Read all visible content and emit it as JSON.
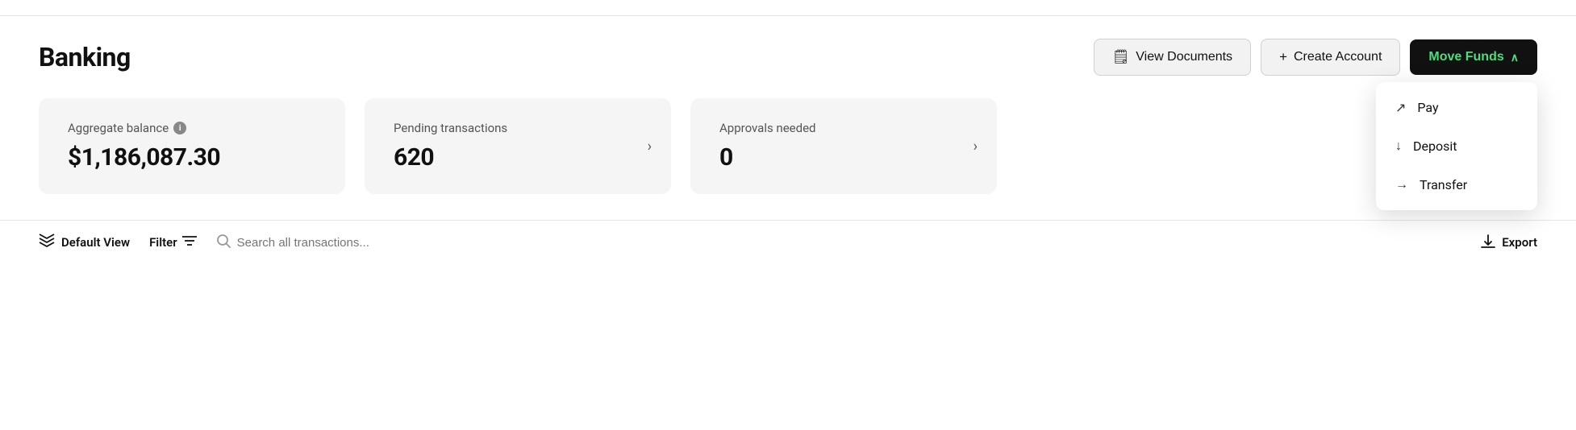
{
  "topbar": {},
  "header": {
    "title": "Banking",
    "actions": {
      "view_documents_label": "View Documents",
      "create_account_label": "Create Account",
      "create_account_prefix": "+",
      "move_funds_label": "Move Funds"
    }
  },
  "dropdown": {
    "items": [
      {
        "id": "pay",
        "label": "Pay",
        "icon": "send"
      },
      {
        "id": "deposit",
        "label": "Deposit",
        "icon": "down-arrow"
      },
      {
        "id": "transfer",
        "label": "Transfer",
        "icon": "right-arrow"
      }
    ]
  },
  "cards": [
    {
      "id": "aggregate-balance",
      "label": "Aggregate balance",
      "has_info": true,
      "value": "$1,186,087.30",
      "has_arrow": false
    },
    {
      "id": "pending-transactions",
      "label": "Pending transactions",
      "has_info": false,
      "value": "620",
      "has_arrow": true
    },
    {
      "id": "approvals-needed",
      "label": "Approvals needed",
      "has_info": false,
      "value": "0",
      "has_arrow": true
    }
  ],
  "bottombar": {
    "default_view_label": "Default View",
    "filter_label": "Filter",
    "search_placeholder": "Search all transactions...",
    "export_label": "Export"
  },
  "icons": {
    "info": "i",
    "layers": "⊜",
    "filter": "≡",
    "search": "🔍",
    "export_arrow": "↓",
    "chevron_up": "∧",
    "chevron_right": "›",
    "doc": "🗒"
  }
}
